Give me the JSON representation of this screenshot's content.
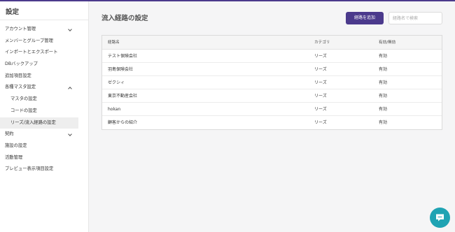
{
  "colors": {
    "accent": "#4b3a8c",
    "chat": "#1fa3b3"
  },
  "sidebar": {
    "title": "設定",
    "items": [
      {
        "label": "アカウント管理",
        "chevron": "down"
      },
      {
        "label": "メンバーとグループ管理"
      },
      {
        "label": "インポートとエクスポート"
      },
      {
        "label": "DBバックアップ"
      },
      {
        "label": "追加項目設定"
      },
      {
        "label": "各種マスタ設定",
        "chevron": "up"
      },
      {
        "label": "マスタの設定",
        "sub": true
      },
      {
        "label": "コードの設定",
        "sub": true
      },
      {
        "label": "リーズ/流入経路の設定",
        "sub": true,
        "active": true
      },
      {
        "label": "契約",
        "chevron": "down"
      },
      {
        "label": "施設の設定"
      },
      {
        "label": "活動管理"
      },
      {
        "label": "プレビュー表示項目設定"
      }
    ]
  },
  "main": {
    "title": "流入経路の設定",
    "add_button": "経路を追加",
    "search": {
      "placeholder": "経路名で検索",
      "value": ""
    },
    "table": {
      "headers": [
        "経路名",
        "カテゴリ",
        "有効/無効"
      ],
      "rows": [
        [
          "テスト保険会社",
          "リーズ",
          "有効"
        ],
        [
          "羽島保険会社",
          "リーズ",
          "有効"
        ],
        [
          "ゼクシィ",
          "リーズ",
          "有効"
        ],
        [
          "東京不動産会社",
          "リーズ",
          "有効"
        ],
        [
          "hokan",
          "リーズ",
          "有効"
        ],
        [
          "顧客からの紹介",
          "リーズ",
          "有効"
        ]
      ]
    }
  },
  "chat_widget": {
    "icon": "chat-bubble-icon"
  }
}
